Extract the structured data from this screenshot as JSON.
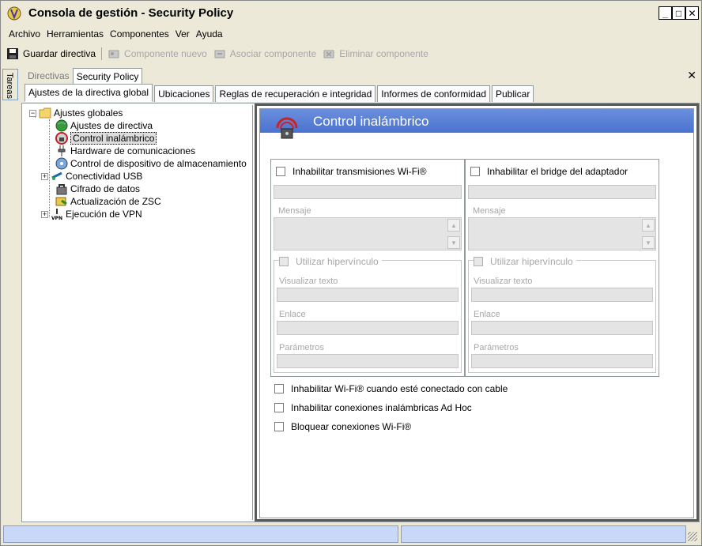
{
  "window": {
    "title": "Consola de gestión - Security Policy",
    "controls": {
      "minimize": "_",
      "maximize": "□",
      "close": "✕"
    }
  },
  "menubar": [
    "Archivo",
    "Herramientas",
    "Componentes",
    "Ver",
    "Ayuda"
  ],
  "toolbar": {
    "save": "Guardar directiva",
    "new_component": "Componente nuevo",
    "associate_component": "Asociar componente",
    "delete_component": "Eliminar componente"
  },
  "side_tab": "Tareas",
  "doc_tabs": [
    "Directivas",
    "Security Policy"
  ],
  "page_tabs": [
    "Ajustes de la directiva global",
    "Ubicaciones",
    "Reglas de recuperación e integridad",
    "Informes de conformidad",
    "Publicar"
  ],
  "tree": {
    "root": "Ajustes globales",
    "items": [
      "Ajustes de directiva",
      "Control inalámbrico",
      "Hardware de comunicaciones",
      "Control de dispositivo de almacenamiento",
      "Conectividad USB",
      "Cifrado de datos",
      "Actualización de ZSC",
      "Ejecución de VPN"
    ],
    "selected": "Control inalámbrico"
  },
  "panel": {
    "title": "Control inalámbrico",
    "left": {
      "checkbox": "Inhabilitar transmisiones Wi-Fi®",
      "message_label": "Mensaje",
      "hyperlink": "Utilizar hipervínculo",
      "display_text_label": "Visualizar texto",
      "link_label": "Enlace",
      "params_label": "Parámetros"
    },
    "right": {
      "checkbox": "Inhabilitar el bridge del adaptador",
      "message_label": "Mensaje",
      "hyperlink": "Utilizar hipervínculo",
      "display_text_label": "Visualizar texto",
      "link_label": "Enlace",
      "params_label": "Parámetros"
    },
    "options": [
      "Inhabilitar Wi-Fi® cuando esté conectado con cable",
      "Inhabilitar conexiones inalámbricas Ad Hoc",
      "Bloquear conexiones Wi-Fi®"
    ]
  },
  "colors": {
    "header_bg": "#5a7fd6",
    "statusbar_bg": "#c9d8f8"
  }
}
